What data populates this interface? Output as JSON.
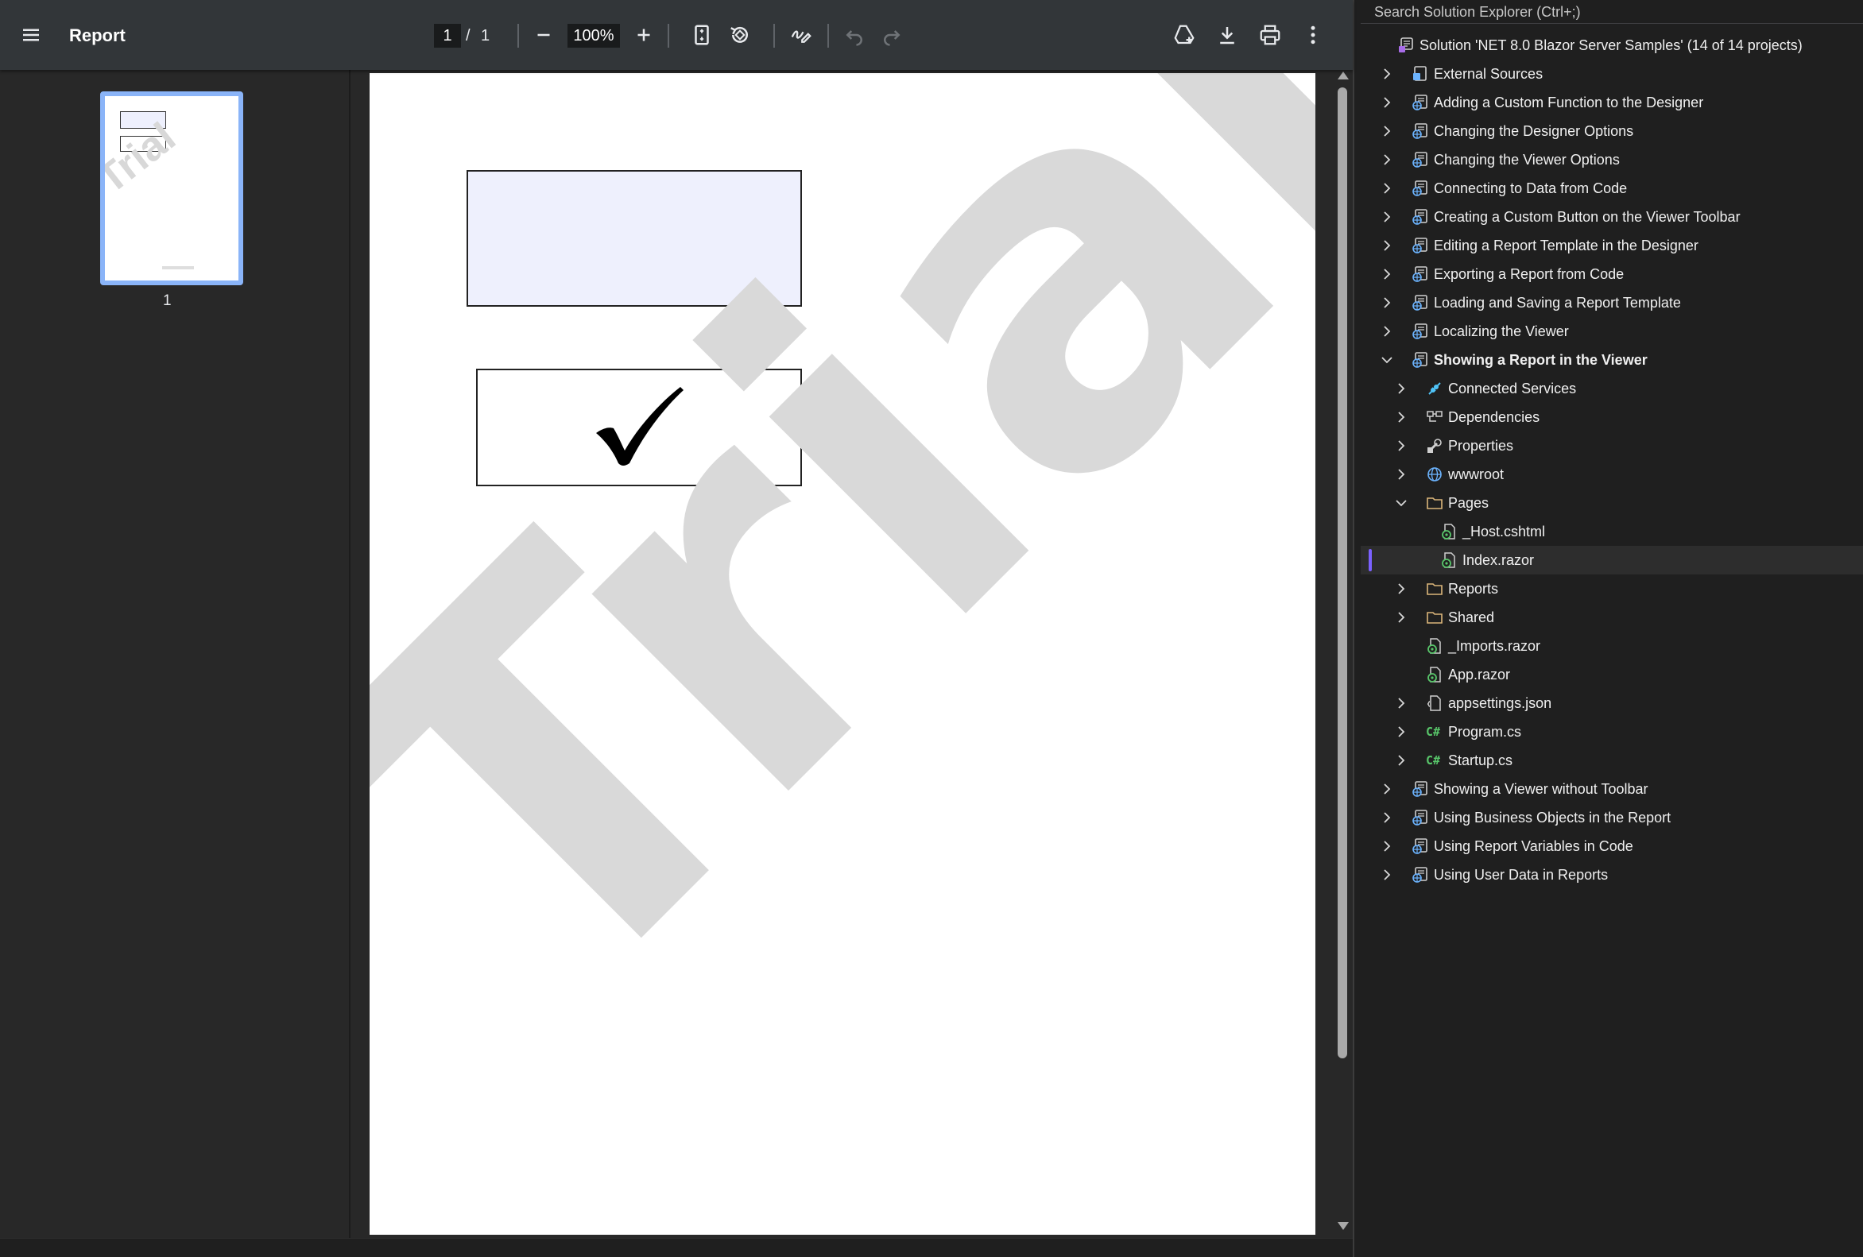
{
  "pdf_viewer": {
    "title": "Report",
    "page_current": "1",
    "page_separator": "/",
    "page_total": "1",
    "zoom": "100%",
    "thumbnail_page_label": "1",
    "watermark_text": "Trial"
  },
  "solution_explorer": {
    "search_placeholder": "Search Solution Explorer (Ctrl+;)",
    "items": [
      {
        "label": "Solution 'NET 8.0 Blazor Server Samples' (14 of 14 projects)",
        "icon": "solution-icon",
        "indent": 0,
        "chevron": "none"
      },
      {
        "label": "External Sources",
        "icon": "external-sources-icon",
        "indent": 1,
        "chevron": "right"
      },
      {
        "label": "Adding a Custom Function to the Designer",
        "icon": "web-project-icon",
        "indent": 1,
        "chevron": "right"
      },
      {
        "label": "Changing the Designer Options",
        "icon": "web-project-icon",
        "indent": 1,
        "chevron": "right"
      },
      {
        "label": "Changing the Viewer Options",
        "icon": "web-project-icon",
        "indent": 1,
        "chevron": "right"
      },
      {
        "label": "Connecting to Data from Code",
        "icon": "web-project-icon",
        "indent": 1,
        "chevron": "right"
      },
      {
        "label": "Creating a Custom Button on the Viewer Toolbar",
        "icon": "web-project-icon",
        "indent": 1,
        "chevron": "right"
      },
      {
        "label": "Editing a Report Template in the Designer",
        "icon": "web-project-icon",
        "indent": 1,
        "chevron": "right"
      },
      {
        "label": "Exporting a Report from Code",
        "icon": "web-project-icon",
        "indent": 1,
        "chevron": "right"
      },
      {
        "label": "Loading and Saving a Report Template",
        "icon": "web-project-icon",
        "indent": 1,
        "chevron": "right"
      },
      {
        "label": "Localizing the Viewer",
        "icon": "web-project-icon",
        "indent": 1,
        "chevron": "right"
      },
      {
        "label": "Showing a Report in the Viewer",
        "icon": "web-project-icon",
        "indent": 1,
        "chevron": "down",
        "bold": true
      },
      {
        "label": "Connected Services",
        "icon": "connected-services-icon",
        "indent": 2,
        "chevron": "right"
      },
      {
        "label": "Dependencies",
        "icon": "dependencies-icon",
        "indent": 2,
        "chevron": "right"
      },
      {
        "label": "Properties",
        "icon": "properties-icon",
        "indent": 2,
        "chevron": "right"
      },
      {
        "label": "wwwroot",
        "icon": "globe-icon",
        "indent": 2,
        "chevron": "right"
      },
      {
        "label": "Pages",
        "icon": "folder-icon",
        "indent": 2,
        "chevron": "down"
      },
      {
        "label": "_Host.cshtml",
        "icon": "razor-file-icon",
        "indent": 3,
        "chevron": "none"
      },
      {
        "label": "Index.razor",
        "icon": "razor-file-icon",
        "indent": 3,
        "chevron": "none",
        "selected": true
      },
      {
        "label": "Reports",
        "icon": "folder-icon",
        "indent": 2,
        "chevron": "right"
      },
      {
        "label": "Shared",
        "icon": "folder-icon",
        "indent": 2,
        "chevron": "right"
      },
      {
        "label": "_Imports.razor",
        "icon": "razor-file-icon",
        "indent": 2,
        "chevron": "none"
      },
      {
        "label": "App.razor",
        "icon": "razor-file-icon",
        "indent": 2,
        "chevron": "none"
      },
      {
        "label": "appsettings.json",
        "icon": "json-file-icon",
        "indent": 2,
        "chevron": "right"
      },
      {
        "label": "Program.cs",
        "icon": "csharp-file-icon",
        "indent": 2,
        "chevron": "right"
      },
      {
        "label": "Startup.cs",
        "icon": "csharp-file-icon",
        "indent": 2,
        "chevron": "right"
      },
      {
        "label": "Showing a Viewer without Toolbar",
        "icon": "web-project-icon",
        "indent": 1,
        "chevron": "right"
      },
      {
        "label": "Using Business Objects in the Report",
        "icon": "web-project-icon",
        "indent": 1,
        "chevron": "right"
      },
      {
        "label": "Using Report Variables in Code",
        "icon": "web-project-icon",
        "indent": 1,
        "chevron": "right"
      },
      {
        "label": "Using User Data in Reports",
        "icon": "web-project-icon",
        "indent": 1,
        "chevron": "right"
      }
    ]
  },
  "colors": {
    "toolbar_bg": "#323639",
    "viewer_bg": "#282828",
    "accent_thumbnail": "#8ab4f8",
    "selection_marker": "#7b61ff",
    "csharp_icon": "#58c66a",
    "project_icon": "#6cb4ff"
  }
}
